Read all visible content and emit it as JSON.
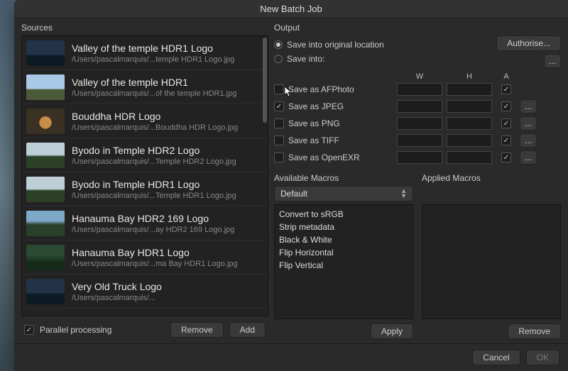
{
  "title": "New Batch Job",
  "sources": {
    "label": "Sources",
    "items": [
      {
        "title": "Valley of the temple HDR1 Logo",
        "path": "/Users/pascalmarquis/...temple HDR1 Logo.jpg",
        "thumb": "dark"
      },
      {
        "title": "Valley of the temple HDR1",
        "path": "/Users/pascalmarquis/...of the temple HDR1.jpg",
        "thumb": "sky"
      },
      {
        "title": "Bouddha HDR Logo",
        "path": "/Users/pascalmarquis/...Bouddha HDR Logo.jpg",
        "thumb": "buddha"
      },
      {
        "title": "Byodo in Temple HDR2 Logo",
        "path": "/Users/pascalmarquis/...Temple HDR2 Logo.jpg",
        "thumb": "temple"
      },
      {
        "title": "Byodo in Temple HDR1 Logo",
        "path": "/Users/pascalmarquis/...Temple HDR1 Logo.jpg",
        "thumb": "temple"
      },
      {
        "title": "Hanauma Bay HDR2 169 Logo",
        "path": "/Users/pascalmarquis/...ay HDR2 169 Logo.jpg",
        "thumb": "bay"
      },
      {
        "title": "Hanauma Bay HDR1 Logo",
        "path": "/Users/pascalmarquis/...ma Bay HDR1 Logo.jpg",
        "thumb": "bay2"
      },
      {
        "title": "Very Old Truck Logo",
        "path": "/Users/pascalmarquis/...",
        "thumb": "dark"
      }
    ],
    "parallel_label": "Parallel processing",
    "parallel_checked": true,
    "remove": "Remove",
    "add": "Add"
  },
  "output": {
    "label": "Output",
    "save_original": "Save into original location",
    "save_into": "Save into:",
    "authorise": "Authorise...",
    "more": "...",
    "cols": {
      "w": "W",
      "h": "H",
      "a": "A"
    },
    "formats": [
      {
        "label": "Save as AFPhoto",
        "checked": false,
        "hasMore": false
      },
      {
        "label": "Save as JPEG",
        "checked": true,
        "hasMore": true
      },
      {
        "label": "Save as PNG",
        "checked": false,
        "hasMore": true
      },
      {
        "label": "Save as TIFF",
        "checked": false,
        "hasMore": true
      },
      {
        "label": "Save as OpenEXR",
        "checked": false,
        "hasMore": true
      }
    ]
  },
  "macros": {
    "available_label": "Available Macros",
    "applied_label": "Applied Macros",
    "selected": "Default",
    "list": [
      "Convert to sRGB",
      "Strip metadata",
      "Black & White",
      "Flip Horizontal",
      "Flip Vertical"
    ],
    "apply": "Apply",
    "remove": "Remove"
  },
  "footer": {
    "cancel": "Cancel",
    "ok": "OK"
  }
}
